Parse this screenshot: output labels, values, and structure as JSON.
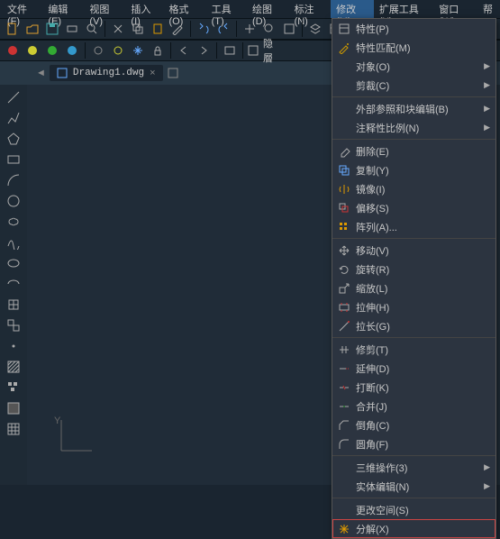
{
  "menubar": [
    "文件(F)",
    "编辑(E)",
    "视图(V)",
    "插入(I)",
    "格式(O)",
    "工具(T)",
    "绘图(D)",
    "标注(N)",
    "修改(M)",
    "扩展工具(X)",
    "窗口(W)",
    "帮"
  ],
  "menubar_active": 8,
  "tab": {
    "name": "Drawing1.dwg",
    "close": "×"
  },
  "toolbar2": {
    "hide_label": "隐層"
  },
  "menu": [
    {
      "icon": "props",
      "label": "特性(P)"
    },
    {
      "icon": "match",
      "label": "特性匹配(M)"
    },
    {
      "icon": "",
      "label": "对象(O)",
      "sub": true
    },
    {
      "icon": "",
      "label": "剪裁(C)",
      "sub": true
    },
    {
      "sep": true
    },
    {
      "icon": "",
      "label": "外部参照和块编辑(B)",
      "sub": true
    },
    {
      "icon": "",
      "label": "注释性比例(N)",
      "sub": true
    },
    {
      "sep": true
    },
    {
      "icon": "erase",
      "label": "删除(E)"
    },
    {
      "icon": "copy",
      "label": "复制(Y)"
    },
    {
      "icon": "mirror",
      "label": "镜像(I)"
    },
    {
      "icon": "offset",
      "label": "偏移(S)"
    },
    {
      "icon": "array",
      "label": "阵列(A)..."
    },
    {
      "sep": true
    },
    {
      "icon": "move",
      "label": "移动(V)"
    },
    {
      "icon": "rotate",
      "label": "旋转(R)"
    },
    {
      "icon": "scale",
      "label": "缩放(L)"
    },
    {
      "icon": "stretch",
      "label": "拉伸(H)"
    },
    {
      "icon": "lengthen",
      "label": "拉长(G)"
    },
    {
      "sep": true
    },
    {
      "icon": "trim",
      "label": "修剪(T)"
    },
    {
      "icon": "extend",
      "label": "延伸(D)"
    },
    {
      "icon": "break",
      "label": "打断(K)"
    },
    {
      "icon": "join",
      "label": "合并(J)"
    },
    {
      "icon": "chamfer",
      "label": "倒角(C)"
    },
    {
      "icon": "fillet",
      "label": "圆角(F)"
    },
    {
      "sep": true
    },
    {
      "icon": "",
      "label": "三维操作(3)",
      "sub": true
    },
    {
      "icon": "",
      "label": "实体编辑(N)",
      "sub": true
    },
    {
      "sep": true
    },
    {
      "icon": "",
      "label": "更改空间(S)"
    },
    {
      "icon": "explode",
      "label": "分解(X)",
      "highlight": true
    }
  ]
}
